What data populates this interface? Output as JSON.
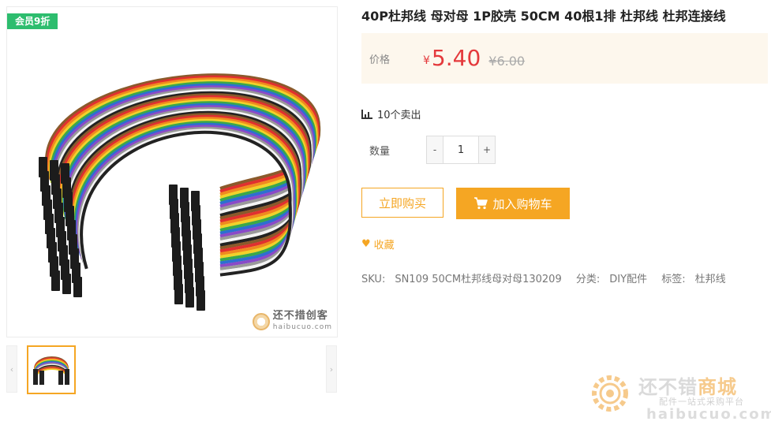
{
  "gallery": {
    "badge": "会员9折",
    "watermark_cn": "还不措创客",
    "watermark_en": "haibucuo.com",
    "prev_arrow": "‹",
    "next_arrow": "›"
  },
  "product": {
    "title": "40P杜邦线 母对母 1P胶壳 50CM 40根1排 杜邦线 杜邦连接线",
    "price_label": "价格",
    "currency": "¥",
    "price": "5.40",
    "old_price": "¥6.00",
    "sold": "10个卖出",
    "qty_label": "数量",
    "qty_minus": "-",
    "qty_value": "1",
    "qty_plus": "+",
    "buy_now": "立即购买",
    "add_cart": "加入购物车",
    "favorite": "收藏",
    "meta": {
      "sku_label": "SKU:",
      "sku": "SN109 50CM杜邦线母对母130209",
      "category_label": "分类:",
      "category": "DIY配件",
      "tag_label": "标签:",
      "tag": "杜邦线"
    }
  },
  "brand_watermark": {
    "title_a": "还不错",
    "title_b": "商城",
    "subtitle": "配件一站式采购平台",
    "url": "haibucuo.com"
  },
  "colors": {
    "accent": "#f5a623",
    "price": "#e4393c",
    "badge": "#2dbd6e",
    "price_bg": "#fdf7ed"
  }
}
